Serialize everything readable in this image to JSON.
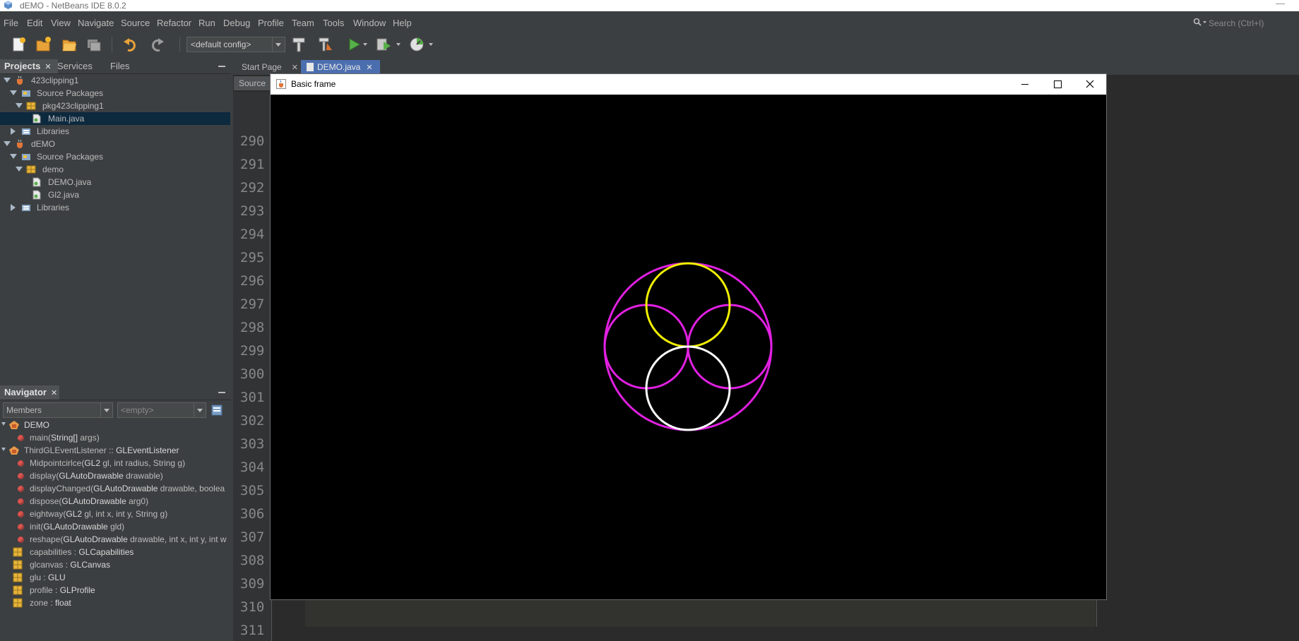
{
  "window": {
    "title": "dEMO - NetBeans IDE 8.0.2"
  },
  "menubar": {
    "items": [
      "File",
      "Edit",
      "View",
      "Navigate",
      "Source",
      "Refactor",
      "Run",
      "Debug",
      "Profile",
      "Team",
      "Tools",
      "Window",
      "Help"
    ],
    "search_placeholder": "Search (Ctrl+I)"
  },
  "toolbar": {
    "config": "<default config>",
    "icons": [
      "new-file-icon",
      "new-project-icon",
      "open-project-icon",
      "close-project-icon",
      "undo-icon",
      "redo-icon",
      "build-icon",
      "clean-build-icon",
      "run-icon",
      "debug-icon",
      "profile-icon"
    ]
  },
  "projects_panel": {
    "tabs": [
      "Projects",
      "Services",
      "Files"
    ],
    "tree": [
      {
        "label": "423clipping1",
        "icon": "java-project-icon",
        "expanded": true
      },
      {
        "label": "Source Packages",
        "icon": "source-packages-icon",
        "expanded": true
      },
      {
        "label": "pkg423clipping1",
        "icon": "package-icon",
        "expanded": true
      },
      {
        "label": "Main.java",
        "icon": "java-file-icon",
        "selected": true
      },
      {
        "label": "Libraries",
        "icon": "libraries-icon",
        "expanded": false
      },
      {
        "label": "dEMO",
        "icon": "java-project-icon",
        "expanded": true
      },
      {
        "label": "Source Packages",
        "icon": "source-packages-icon",
        "expanded": true
      },
      {
        "label": "demo",
        "icon": "package-icon",
        "expanded": true
      },
      {
        "label": "DEMO.java",
        "icon": "java-file-icon"
      },
      {
        "label": "Gl2.java",
        "icon": "java-file-icon"
      },
      {
        "label": "Libraries",
        "icon": "libraries-icon",
        "expanded": false
      }
    ]
  },
  "navigator": {
    "title": "Navigator",
    "members_combo": "Members",
    "filter_combo": "<empty>",
    "items": [
      {
        "prefix": "",
        "keyword": "DEMO",
        "suffix": "",
        "kind": "class"
      },
      {
        "prefix": "main(",
        "keyword": "String[]",
        "suffix": " args)",
        "kind": "method-static"
      },
      {
        "prefix": "ThirdGLEventListener :: ",
        "keyword": "GLEventListener",
        "suffix": "",
        "kind": "class"
      },
      {
        "prefix": "Midpointcirlce(",
        "keyword": "GL2",
        "suffix": " gl, int radius, String g)",
        "kind": "method"
      },
      {
        "prefix": "display(",
        "keyword": "GLAutoDrawable",
        "suffix": " drawable)",
        "kind": "method"
      },
      {
        "prefix": "displayChanged(",
        "keyword": "GLAutoDrawable",
        "suffix": " drawable, boolea",
        "kind": "method"
      },
      {
        "prefix": "dispose(",
        "keyword": "GLAutoDrawable",
        "suffix": " arg0)",
        "kind": "method"
      },
      {
        "prefix": "eightway(",
        "keyword": "GL2",
        "suffix": " gl, int x, int y, String g)",
        "kind": "method"
      },
      {
        "prefix": "init(",
        "keyword": "GLAutoDrawable",
        "suffix": " gld)",
        "kind": "method"
      },
      {
        "prefix": "reshape(",
        "keyword": "GLAutoDrawable",
        "suffix": " drawable, int x, int y, int w",
        "kind": "method"
      },
      {
        "prefix": "capabilities : ",
        "keyword": "GLCapabilities",
        "suffix": "",
        "kind": "field"
      },
      {
        "prefix": "glcanvas : ",
        "keyword": "GLCanvas",
        "suffix": "",
        "kind": "field"
      },
      {
        "prefix": "glu : ",
        "keyword": "GLU",
        "suffix": "",
        "kind": "field"
      },
      {
        "prefix": "profile : ",
        "keyword": "GLProfile",
        "suffix": "",
        "kind": "field"
      },
      {
        "prefix": "zone : ",
        "keyword": "float",
        "suffix": "",
        "kind": "field"
      }
    ]
  },
  "editor": {
    "tabs": [
      "Start Page",
      "DEMO.java"
    ],
    "active_tab": "DEMO.java",
    "source_tab": "Source",
    "line_numbers": [
      "290",
      "291",
      "292",
      "293",
      "294",
      "295",
      "296",
      "297",
      "298",
      "299",
      "300",
      "301",
      "302",
      "303",
      "304",
      "305",
      "306",
      "307",
      "308",
      "309",
      "310",
      "311"
    ]
  },
  "frame": {
    "title": "Basic frame",
    "circles": [
      {
        "name": "outer",
        "color": "#e020e0"
      },
      {
        "name": "left",
        "color": "#e020e0"
      },
      {
        "name": "right",
        "color": "#e020e0"
      },
      {
        "name": "top",
        "color": "#f0f000"
      },
      {
        "name": "bottom",
        "color": "#ffffff"
      }
    ]
  }
}
